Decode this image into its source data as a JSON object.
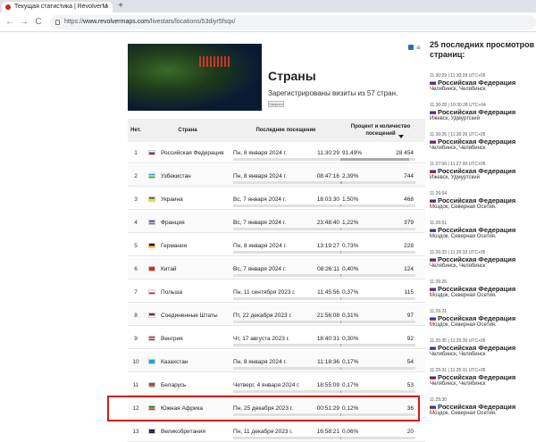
{
  "browser": {
    "tab_title": "Текущая статистика | RevolverM",
    "tab_close": "×",
    "new_tab": "+",
    "back": "←",
    "forward": "→",
    "reload": "C",
    "home": "⌂",
    "url_prefix": "https://",
    "url_domain": "www.revolvermaps.com",
    "url_path": "/livestats/locations/53diyr5fsqx/"
  },
  "header": {
    "title": "Страны",
    "subtitle": "Зарегистрированы визиты из 57 стран.",
    "small_button": "Закрыть",
    "list_icon_label": "≡"
  },
  "table": {
    "headers": {
      "num": "Нет.",
      "country": "Страна",
      "last_visit": "Последнее посещение",
      "percent": "Процент и количество посещений"
    },
    "rows": [
      {
        "num": "1",
        "country": "Российская Федерация",
        "date": "Пн, 8 января 2024 г.",
        "time": "11:30:29",
        "pct": "91,49%",
        "count": "28 454",
        "share": 0.9149,
        "flag": [
          "#ffffff",
          "#1c3faa",
          "#d52b1e"
        ]
      },
      {
        "num": "2",
        "country": "Узбекистан",
        "date": "Пн, 8 января 2024 г.",
        "time": "08:47:16",
        "pct": "2,39%",
        "count": "744",
        "share": 0.0239,
        "flag": [
          "#1eb1e7",
          "#ffffff",
          "#1eb53a"
        ]
      },
      {
        "num": "3",
        "country": "Украина",
        "date": "Вс, 7 января 2024 г.",
        "time": "18:03:30",
        "pct": "1,50%",
        "count": "468",
        "share": 0.015,
        "flag": [
          "#0057b7",
          "#ffd700",
          "#ffd700"
        ]
      },
      {
        "num": "4",
        "country": "Франция",
        "date": "Вс, 7 января 2024 г.",
        "time": "23:48:40",
        "pct": "1,22%",
        "count": "379",
        "share": 0.0122,
        "flag": [
          "#0055a4",
          "#ffffff",
          "#ef4135"
        ]
      },
      {
        "num": "5",
        "country": "Германия",
        "date": "Пн, 8 января 2024 г.",
        "time": "13:19:27",
        "pct": "0,73%",
        "count": "228",
        "share": 0.0073,
        "flag": [
          "#000000",
          "#dd0000",
          "#ffce00"
        ]
      },
      {
        "num": "6",
        "country": "Китай",
        "date": "Вс, 7 января 2024 г.",
        "time": "08:26:11",
        "pct": "0,40%",
        "count": "124",
        "share": 0.004,
        "flag": [
          "#de2910",
          "#de2910",
          "#de2910"
        ]
      },
      {
        "num": "7",
        "country": "Польша",
        "date": "Пн, 11 сентября 2023 г.",
        "time": "11:45:56",
        "pct": "0,37%",
        "count": "115",
        "share": 0.0037,
        "flag": [
          "#ffffff",
          "#ffffff",
          "#dc143c"
        ]
      },
      {
        "num": "8",
        "country": "Соединенные Штаты",
        "date": "Пт, 22 декабря 2023 г.",
        "time": "21:56:08",
        "pct": "0,31%",
        "count": "97",
        "share": 0.0031,
        "flag": [
          "#3c3b6e",
          "#b22234",
          "#ffffff"
        ]
      },
      {
        "num": "9",
        "country": "Венгрия",
        "date": "Чт, 17 августа 2023 г.",
        "time": "18:40:31",
        "pct": "0,30%",
        "count": "92",
        "share": 0.003,
        "flag": [
          "#ce2939",
          "#ffffff",
          "#477050"
        ]
      },
      {
        "num": "10",
        "country": "Казахстан",
        "date": "Пн, 8 января 2024 г.",
        "time": "11:18:36",
        "pct": "0,17%",
        "count": "54",
        "share": 0.0017,
        "flag": [
          "#00afca",
          "#00afca",
          "#00afca"
        ]
      },
      {
        "num": "11",
        "country": "Беларусь",
        "date": "Четверг, 4 января 2024 г.",
        "time": "18:55:09",
        "pct": "0,17%",
        "count": "53",
        "share": 0.0017,
        "flag": [
          "#c8313e",
          "#c8313e",
          "#4aa657"
        ]
      },
      {
        "num": "12",
        "country": "Южная Африка",
        "date": "Пн, 25 декабря 2023 г.",
        "time": "00:51:29",
        "pct": "0,12%",
        "count": "36",
        "share": 0.0012,
        "flag": [
          "#007a4d",
          "#ffb612",
          "#de3831"
        ]
      },
      {
        "num": "13",
        "country": "Великобритания",
        "date": "Пн, 11 декабря 2023 г.",
        "time": "16:58:21",
        "pct": "0,06%",
        "count": "20",
        "share": 0.0006,
        "flag": [
          "#012169",
          "#c8102e",
          "#012169"
        ]
      }
    ]
  },
  "sidebar": {
    "title": "25 последних просмотров страниц:",
    "visits": [
      {
        "time": "11:30:29 | 11:30:29 UTC+05",
        "country": "Российская Федерация",
        "location": "Челябинск, Челябинск"
      },
      {
        "time": "11:30:28 | 10:30:28 UTC+04",
        "country": "Российская Федерация",
        "location": "Ижевск, Удмуртский"
      },
      {
        "time": "11:30:26 | 11:30:26 UTC+05",
        "country": "Российская Федерация",
        "location": "Челябинск, Челябинск"
      },
      {
        "time": "11:27:00 | 11:27:00 UTC+05",
        "country": "Российская Федерация",
        "location": "Ижевск, Удмуртский"
      },
      {
        "time": "11:26:54",
        "country": "Российская Федерация",
        "location": "Моздок, Северная Осетия."
      },
      {
        "time": "11:26:51",
        "country": "Российская Федерация",
        "location": "Моздок, Северная Осетия."
      },
      {
        "time": "11:26:33 | 11:26:33 UTC+05",
        "country": "Российская Федерация",
        "location": "Челябинск, Челябинск"
      },
      {
        "time": "11:26:26",
        "country": "Российская Федерация",
        "location": "Моздок, Северная Осетия."
      },
      {
        "time": "11:26:21",
        "country": "Российская Федерация",
        "location": "Моздок, Северная Осетия."
      },
      {
        "time": "11:25:35 | 11:25:35 UTC+05",
        "country": "Российская Федерация",
        "location": "Челябинск, Челябинск"
      },
      {
        "time": "11:25:31 | 11:25:31 UTC+05",
        "country": "Российская Федерация",
        "location": "Челябинск, Челябинск"
      },
      {
        "time": "11:25:30",
        "country": "Российская Федерация",
        "location": "Моздок, Северная Осетия."
      }
    ]
  }
}
